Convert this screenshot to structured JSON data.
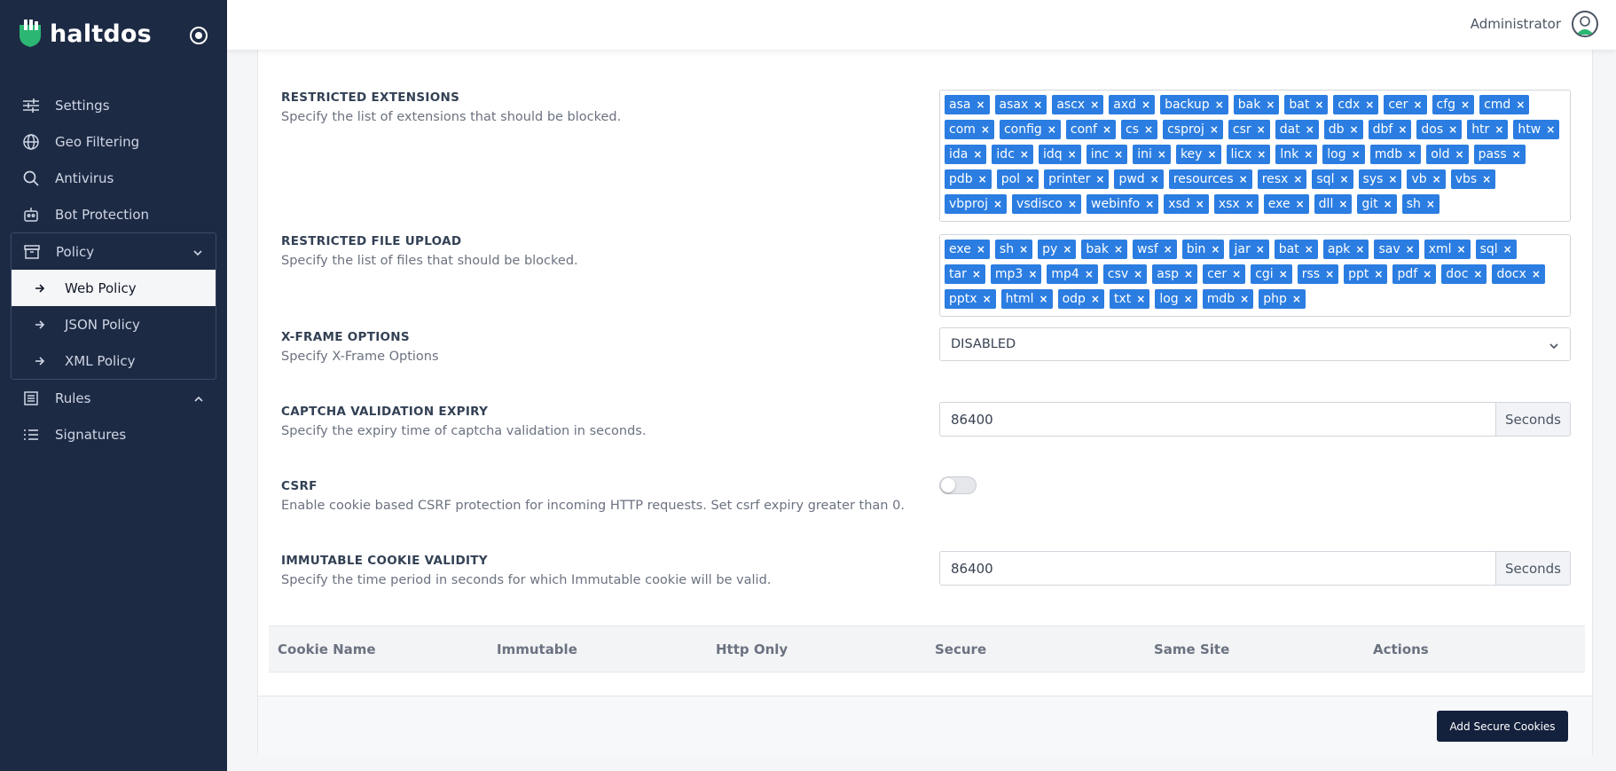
{
  "brand": {
    "name": "haltdos"
  },
  "header": {
    "user": "Administrator"
  },
  "sidebar": {
    "items": [
      {
        "label": "Settings",
        "icon": "sliders-icon"
      },
      {
        "label": "Geo Filtering",
        "icon": "globe-icon"
      },
      {
        "label": "Antivirus",
        "icon": "search-icon"
      },
      {
        "label": "Bot Protection",
        "icon": "robot-icon"
      },
      {
        "label": "Policy",
        "icon": "archive-icon"
      },
      {
        "label": "Rules",
        "icon": "list-box-icon"
      },
      {
        "label": "Signatures",
        "icon": "list-icon"
      }
    ],
    "policy_sub": [
      {
        "label": "Web Policy",
        "active": true
      },
      {
        "label": "JSON Policy",
        "active": false
      },
      {
        "label": "XML Policy",
        "active": false
      }
    ]
  },
  "form": {
    "restricted_extensions": {
      "label": "RESTRICTED EXTENSIONS",
      "desc": "Specify the list of extensions that should be blocked.",
      "tags": [
        "asa",
        "asax",
        "ascx",
        "axd",
        "backup",
        "bak",
        "bat",
        "cdx",
        "cer",
        "cfg",
        "cmd",
        "com",
        "config",
        "conf",
        "cs",
        "csproj",
        "csr",
        "dat",
        "db",
        "dbf",
        "dos",
        "htr",
        "htw",
        "ida",
        "idc",
        "idq",
        "inc",
        "ini",
        "key",
        "licx",
        "lnk",
        "log",
        "mdb",
        "old",
        "pass",
        "pdb",
        "pol",
        "printer",
        "pwd",
        "resources",
        "resx",
        "sql",
        "sys",
        "vb",
        "vbs",
        "vbproj",
        "vsdisco",
        "webinfo",
        "xsd",
        "xsx",
        "exe",
        "dll",
        "git",
        "sh"
      ]
    },
    "restricted_file_upload": {
      "label": "RESTRICTED FILE UPLOAD",
      "desc": "Specify the list of files that should be blocked.",
      "tags": [
        "exe",
        "sh",
        "py",
        "bak",
        "wsf",
        "bin",
        "jar",
        "bat",
        "apk",
        "sav",
        "xml",
        "sql",
        "tar",
        "mp3",
        "mp4",
        "csv",
        "asp",
        "cer",
        "cgi",
        "rss",
        "ppt",
        "pdf",
        "doc",
        "docx",
        "pptx",
        "html",
        "odp",
        "txt",
        "log",
        "mdb",
        "php"
      ]
    },
    "xframe": {
      "label": "X-FRAME OPTIONS",
      "desc": "Specify X-Frame Options",
      "value": "DISABLED"
    },
    "captcha": {
      "label": "CAPTCHA VALIDATION EXPIRY",
      "desc": "Specify the expiry time of captcha validation in seconds.",
      "value": "86400",
      "unit": "Seconds"
    },
    "csrf": {
      "label": "CSRF",
      "desc": "Enable cookie based CSRF protection for incoming HTTP requests. Set csrf expiry greater than 0.",
      "enabled": false
    },
    "immutable": {
      "label": "IMMUTABLE COOKIE VALIDITY",
      "desc": "Specify the time period in seconds for which Immutable cookie will be valid.",
      "value": "86400",
      "unit": "Seconds"
    }
  },
  "table": {
    "headers": [
      "Cookie Name",
      "Immutable",
      "Http Only",
      "Secure",
      "Same Site",
      "Actions"
    ]
  },
  "footer": {
    "add_button": "Add Secure Cookies"
  },
  "colors": {
    "sidebar": "#1d2a44",
    "tag": "#2b7de1",
    "brand_green": "#2bb673",
    "button": "#14213d"
  }
}
